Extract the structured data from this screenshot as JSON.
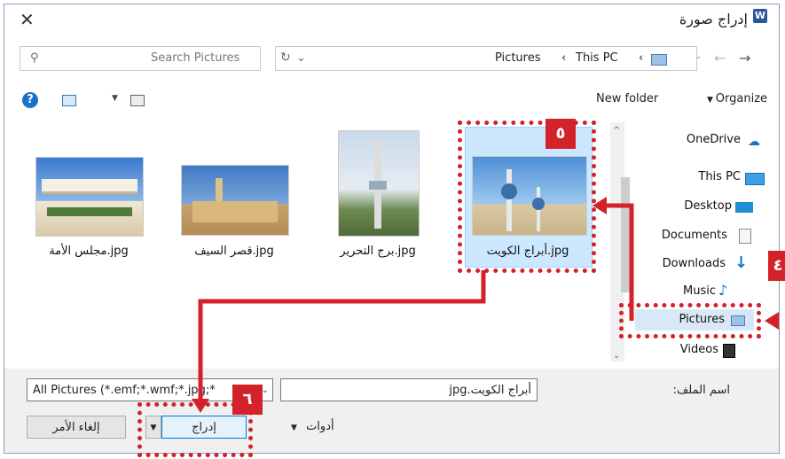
{
  "window": {
    "title": "إدراج صورة",
    "app_icon": "W"
  },
  "address": {
    "path": [
      "Pictures",
      "This PC"
    ],
    "sep": "‹"
  },
  "search": {
    "placeholder": "Search Pictures"
  },
  "toolbar": {
    "organize": "Organize",
    "new_folder": "New folder"
  },
  "sidebar": {
    "items": [
      "OneDrive",
      "This PC",
      "Desktop",
      "Documents",
      "Downloads",
      "Music",
      "Pictures",
      "Videos"
    ]
  },
  "files": [
    {
      "name": "jpg.أبراج الكويت"
    },
    {
      "name": "jpg.برج التحرير"
    },
    {
      "name": "jpg.قصر السيف"
    },
    {
      "name": "jpg.مجلس الأمة"
    }
  ],
  "filename": {
    "label": "اسم الملف:",
    "value": "أبراج الكويت.jpg"
  },
  "filetype": {
    "value": "All Pictures (*.emf;*.wmf;*.jpg;*"
  },
  "buttons": {
    "insert": "إدراج",
    "cancel": "إلغاء الأمر",
    "tools": "أدوات"
  },
  "badges": {
    "b4": "٤",
    "b5": "٥",
    "b6": "٦"
  },
  "colors": {
    "accent_red": "#d3222a",
    "selected": "#cce8ff"
  }
}
